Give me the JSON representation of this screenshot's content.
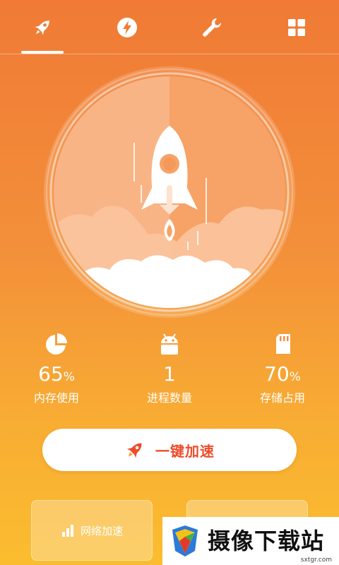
{
  "tabs": [
    {
      "name": "boost",
      "icon": "rocket-icon",
      "active": true
    },
    {
      "name": "power",
      "icon": "lightning-icon",
      "active": false
    },
    {
      "name": "tools",
      "icon": "wrench-icon",
      "active": false
    },
    {
      "name": "more",
      "icon": "grid-icon",
      "active": false
    }
  ],
  "stats": [
    {
      "value": "65",
      "unit": "%",
      "label": "内存使用",
      "icon": "pie-chart-icon"
    },
    {
      "value": "1",
      "unit": "",
      "label": "进程数量",
      "icon": "android-icon"
    },
    {
      "value": "70",
      "unit": "%",
      "label": "存储占用",
      "icon": "sd-card-icon"
    }
  ],
  "boost_button": {
    "label": "一键加速",
    "icon": "rocket-icon"
  },
  "cards": [
    {
      "label": "网络加速",
      "icon": "signal-bars-icon"
    },
    {
      "label": "",
      "icon": ""
    }
  ],
  "watermark": {
    "brand": "摄像下载站",
    "domain": "sxtgr.com"
  },
  "colors": {
    "accent": "#ee4b2b",
    "bg_top": "#f07a36",
    "bg_bottom": "#fbbd2f"
  }
}
